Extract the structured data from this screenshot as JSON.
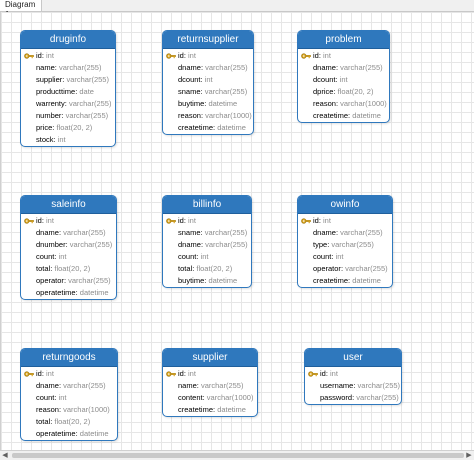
{
  "tab": {
    "label": "Diagram 1"
  },
  "tables": [
    {
      "name": "druginfo",
      "fields": [
        {
          "name": "id",
          "type": "int",
          "pk": true
        },
        {
          "name": "name",
          "type": "varchar(255)"
        },
        {
          "name": "supplier",
          "type": "varchar(255)"
        },
        {
          "name": "producttime",
          "type": "date"
        },
        {
          "name": "warrenty",
          "type": "varchar(255)"
        },
        {
          "name": "number",
          "type": "varchar(255)"
        },
        {
          "name": "price",
          "type": "float(20, 2)"
        },
        {
          "name": "stock",
          "type": "int"
        }
      ]
    },
    {
      "name": "returnsupplier",
      "fields": [
        {
          "name": "id",
          "type": "int",
          "pk": true
        },
        {
          "name": "dname",
          "type": "varchar(255)"
        },
        {
          "name": "dcount",
          "type": "int"
        },
        {
          "name": "sname",
          "type": "varchar(255)"
        },
        {
          "name": "buytime",
          "type": "datetime"
        },
        {
          "name": "reason",
          "type": "varchar(1000)"
        },
        {
          "name": "createtime",
          "type": "datetime"
        }
      ]
    },
    {
      "name": "problem",
      "fields": [
        {
          "name": "id",
          "type": "int",
          "pk": true
        },
        {
          "name": "dname",
          "type": "varchar(255)"
        },
        {
          "name": "dcount",
          "type": "int"
        },
        {
          "name": "dprice",
          "type": "float(20, 2)"
        },
        {
          "name": "reason",
          "type": "varchar(1000)"
        },
        {
          "name": "createtime",
          "type": "datetime"
        }
      ]
    },
    {
      "name": "saleinfo",
      "fields": [
        {
          "name": "id",
          "type": "int",
          "pk": true
        },
        {
          "name": "dname",
          "type": "varchar(255)"
        },
        {
          "name": "dnumber",
          "type": "varchar(255)"
        },
        {
          "name": "count",
          "type": "int"
        },
        {
          "name": "total",
          "type": "float(20, 2)"
        },
        {
          "name": "operator",
          "type": "varchar(255)"
        },
        {
          "name": "operatetime",
          "type": "datetime"
        }
      ]
    },
    {
      "name": "billinfo",
      "fields": [
        {
          "name": "id",
          "type": "int",
          "pk": true
        },
        {
          "name": "sname",
          "type": "varchar(255)"
        },
        {
          "name": "dname",
          "type": "varchar(255)"
        },
        {
          "name": "count",
          "type": "int"
        },
        {
          "name": "total",
          "type": "float(20, 2)"
        },
        {
          "name": "buytime",
          "type": "datetime"
        }
      ]
    },
    {
      "name": "owinfo",
      "fields": [
        {
          "name": "id",
          "type": "int",
          "pk": true
        },
        {
          "name": "dname",
          "type": "varchar(255)"
        },
        {
          "name": "type",
          "type": "varchar(255)"
        },
        {
          "name": "count",
          "type": "int"
        },
        {
          "name": "operator",
          "type": "varchar(255)"
        },
        {
          "name": "createtime",
          "type": "datetime"
        }
      ]
    },
    {
      "name": "returngoods",
      "fields": [
        {
          "name": "id",
          "type": "int",
          "pk": true
        },
        {
          "name": "dname",
          "type": "varchar(255)"
        },
        {
          "name": "count",
          "type": "int"
        },
        {
          "name": "reason",
          "type": "varchar(1000)"
        },
        {
          "name": "total",
          "type": "float(20, 2)"
        },
        {
          "name": "operatetime",
          "type": "datetime"
        }
      ]
    },
    {
      "name": "supplier",
      "fields": [
        {
          "name": "id",
          "type": "int",
          "pk": true
        },
        {
          "name": "name",
          "type": "varchar(255)"
        },
        {
          "name": "content",
          "type": "varchar(1000)"
        },
        {
          "name": "createtime",
          "type": "datetime"
        }
      ]
    },
    {
      "name": "user",
      "fields": [
        {
          "name": "id",
          "type": "int",
          "pk": true
        },
        {
          "name": "username",
          "type": "varchar(255)"
        },
        {
          "name": "password",
          "type": "varchar(255)"
        }
      ]
    }
  ],
  "colors": {
    "header": "#2f78bd",
    "type_text": "#8c8c8c",
    "key": "#d9a520"
  },
  "icons": {
    "primary_key": "key-icon"
  }
}
